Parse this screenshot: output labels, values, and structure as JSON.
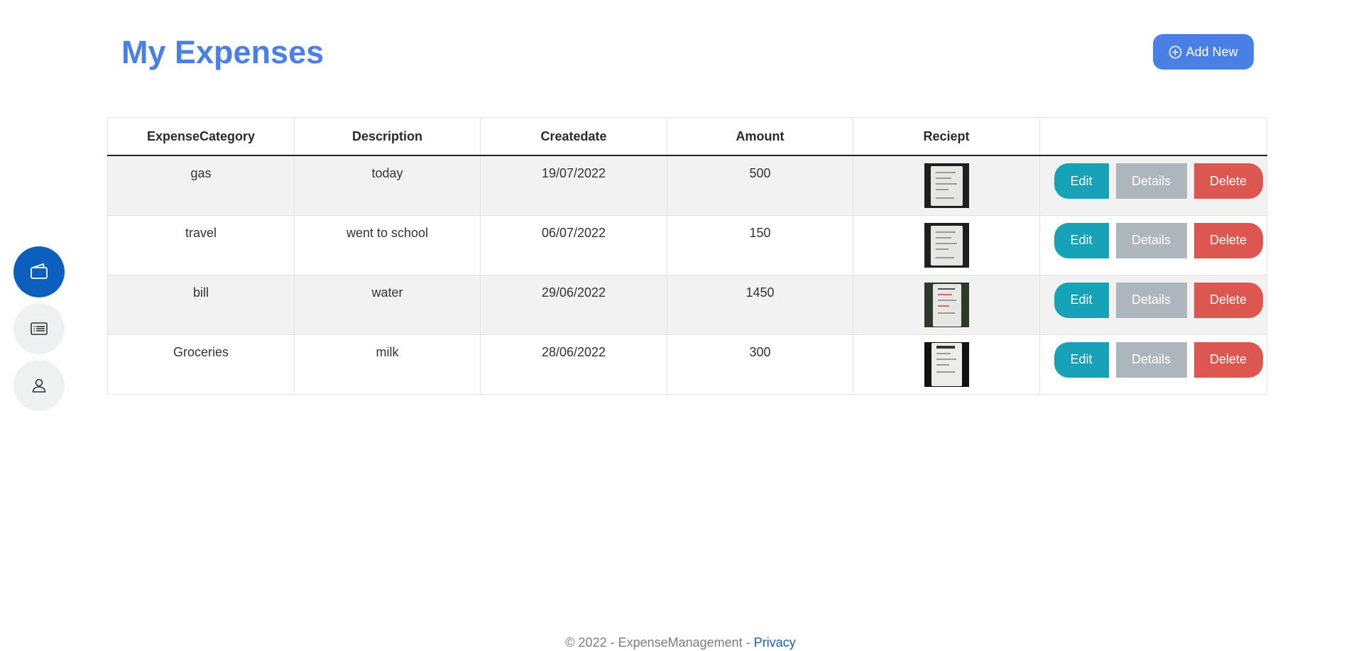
{
  "header": {
    "title": "My Expenses",
    "add_new_label": "Add New"
  },
  "nav": [
    {
      "name": "wallet-icon",
      "active": true
    },
    {
      "name": "list-icon",
      "active": false
    },
    {
      "name": "user-icon",
      "active": false
    }
  ],
  "table": {
    "columns": [
      "ExpenseCategory",
      "Description",
      "Createdate",
      "Amount",
      "Reciept",
      ""
    ],
    "rows": [
      {
        "category": "gas",
        "description": "today",
        "date": "19/07/2022",
        "amount": "500"
      },
      {
        "category": "travel",
        "description": "went to school",
        "date": "06/07/2022",
        "amount": "150"
      },
      {
        "category": "bill",
        "description": "water",
        "date": "29/06/2022",
        "amount": "1450"
      },
      {
        "category": "Groceries",
        "description": "milk",
        "date": "28/06/2022",
        "amount": "300"
      }
    ],
    "actions": {
      "edit": "Edit",
      "details": "Details",
      "delete": "Delete"
    }
  },
  "footer": {
    "text": "© 2022 - ExpenseManagement - ",
    "privacy_link": "Privacy"
  },
  "colors": {
    "accent": "#4a80e6",
    "nav_active": "#0d5fbd",
    "edit": "#17a2b8",
    "details": "#adb5bd",
    "delete": "#dc5750"
  }
}
